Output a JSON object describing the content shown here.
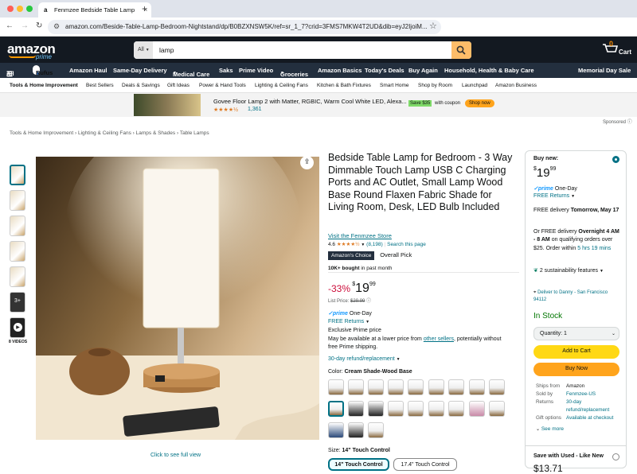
{
  "browser": {
    "tab_title": "Fenmzee Bedside Table Lamp",
    "url": "amazon.com/Beside-Table-Lamp-Bedroom-Nightstand/dp/B0BZXNSW5K/ref=sr_1_7?crid=3FMS7MKW4T2UD&dib=eyJ2IjoiM...",
    "colors": {
      "close": "#ff5f57",
      "min": "#febc2e",
      "max": "#28c840"
    }
  },
  "header": {
    "logo": "amazon",
    "logo_sub": "prime",
    "search_category": "All",
    "search_value": "lamp",
    "cart_count": "0",
    "cart_label": "Cart"
  },
  "nav2": {
    "all": "All",
    "rufus": "Rufus",
    "items": [
      "Amazon Haul",
      "Same-Day Delivery",
      "Medical Care",
      "Saks",
      "Prime Video",
      "Groceries",
      "Amazon Basics",
      "Today's Deals",
      "Buy Again",
      "Household, Health & Baby Care"
    ],
    "promo": "Memorial Day Sale"
  },
  "nav3": {
    "items": [
      "Tools & Home Improvement",
      "Best Sellers",
      "Deals & Savings",
      "Gift Ideas",
      "Power & Hand Tools",
      "Lighting & Ceiling Fans",
      "Kitchen & Bath Fixtures",
      "Smart Home",
      "Shop by Room",
      "Launchpad",
      "Amazon Business"
    ]
  },
  "ad": {
    "title": "Govee Floor Lamp 2 with Matter, RGBIC, Warm Cool White LED, Alexa...",
    "rating_count": "1,361",
    "save_badge": "Save $35",
    "coupon_text": "with coupon",
    "shop_btn": "Shop now",
    "sponsored": "Sponsored"
  },
  "breadcrumb": [
    "Tools & Home Improvement",
    "Lighting & Ceiling Fans",
    "Lamps & Shades",
    "Table Lamps"
  ],
  "gallery": {
    "videos_label": "8 VIDEOS",
    "more_count": "3+",
    "full_view": "Click to see full view"
  },
  "product": {
    "title": "Bedside Table Lamp for Bedroom - 3 Way Dimmable Touch Lamp USB C Charging Ports and AC Outlet, Small Lamp Wood Base Round Flaxen Fabric Shade for Living Room, Desk, LED Bulb Included",
    "store": "Visit the Fenmzee Store",
    "rating": "4.6",
    "rating_count": "(8,198)",
    "search_page": "Search this page",
    "choice_badge": "Amazon's Choice",
    "overall_pick": "Overall Pick",
    "bought": "10K+ bought",
    "bought_suffix": "in past month",
    "discount": "-33%",
    "price_whole": "19",
    "price_frac": "99",
    "list_label": "List Price:",
    "list_price": "$29.99",
    "one_day": "One-Day",
    "free_returns": "FREE Returns",
    "exclusive": "Exclusive Prime price",
    "lower_price_pre": "May be available at a lower price from ",
    "lower_price_link": "other sellers",
    "lower_price_post": ", potentially without free Prime shipping.",
    "refund": "30-day refund/replacement",
    "color_label": "Color:",
    "color_value": "Cream Shade-Wood Base",
    "size_label": "Size:",
    "size_value": "14\" Touch Control",
    "size_options": [
      "14\" Touch Control",
      "17.4\" Touch Control"
    ]
  },
  "buybox": {
    "buy_new": "Buy new:",
    "price_whole": "19",
    "price_frac": "99",
    "one_day": "One-Day",
    "free_returns": "FREE Returns",
    "delivery1_pre": "FREE delivery ",
    "delivery1_bold": "Tomorrow, May 17",
    "delivery2_pre": "Or FREE delivery ",
    "delivery2_bold": "Overnight 4 AM - 8 AM",
    "delivery2_post": " on qualifying orders over $25. Order within ",
    "delivery2_time": "5 hrs 19 mins",
    "sustain": "2 sustainability features",
    "deliver_to": "Deliver to Danny - San Francisco 94112",
    "stock": "In Stock",
    "qty": "Quantity: 1",
    "add_cart": "Add to Cart",
    "buy_now": "Buy Now",
    "details": [
      {
        "k": "Ships from",
        "v": "Amazon"
      },
      {
        "k": "Sold by",
        "v": "Fenmzee-US"
      },
      {
        "k": "Returns",
        "v": "30-day refund/replacement"
      },
      {
        "k": "Gift options",
        "v": "Available at checkout"
      }
    ],
    "see_more": "See more",
    "used_label": "Save with Used - Like New",
    "used_price": "$13.71"
  }
}
